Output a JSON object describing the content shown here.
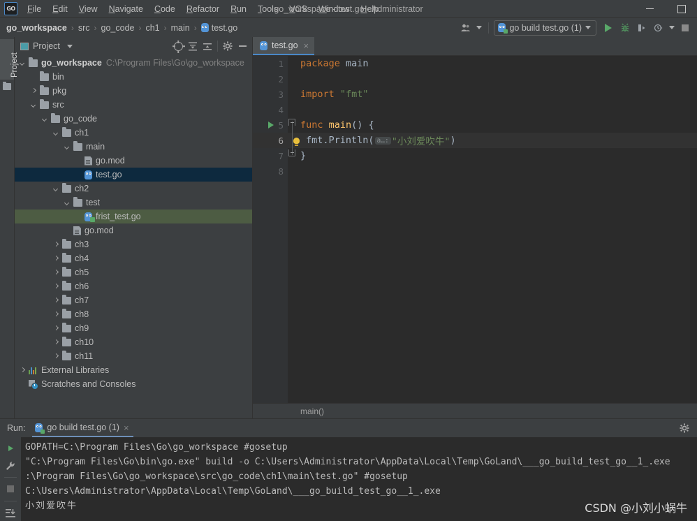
{
  "window": {
    "title": "go_workspace - test.go - Administrator",
    "logo": "goland-logo",
    "minimize": "minimize-button",
    "maximize": "maximize-button"
  },
  "menubar": {
    "items": [
      {
        "label": "File",
        "mnemonic": "F"
      },
      {
        "label": "Edit",
        "mnemonic": "E"
      },
      {
        "label": "View",
        "mnemonic": "V"
      },
      {
        "label": "Navigate",
        "mnemonic": "N"
      },
      {
        "label": "Code",
        "mnemonic": "C"
      },
      {
        "label": "Refactor",
        "mnemonic": "R"
      },
      {
        "label": "Run",
        "mnemonic": "R"
      },
      {
        "label": "Tools",
        "mnemonic": "T"
      },
      {
        "label": "VCS",
        "mnemonic": "V"
      },
      {
        "label": "Window",
        "mnemonic": "W"
      },
      {
        "label": "Help",
        "mnemonic": "H"
      }
    ]
  },
  "navbar": {
    "breadcrumbs": [
      {
        "label": "go_workspace",
        "bold": true
      },
      {
        "label": "src",
        "bold": false
      },
      {
        "label": "go_code",
        "bold": false
      },
      {
        "label": "ch1",
        "bold": false
      },
      {
        "label": "main",
        "bold": false
      },
      {
        "label": "test.go",
        "bold": false,
        "icon": "go-file-icon"
      }
    ],
    "separator": "›",
    "run_config": "go build test.go (1)",
    "icons": [
      "people-icon",
      "run-icon",
      "debug-icon",
      "run-coverage-icon",
      "profile-icon",
      "stop-icon"
    ]
  },
  "left_strip": {
    "tab_label": "Project"
  },
  "project_panel": {
    "title": "Project",
    "toolbar_icons": [
      "locate-icon",
      "expand-all-icon",
      "collapse-all-icon",
      "settings-gear-icon",
      "hide-icon"
    ],
    "tree": [
      {
        "depth": 0,
        "arrow": "down",
        "icon": "folder",
        "label": "go_workspace",
        "bold": true,
        "path": "C:\\Program Files\\Go\\go_workspace",
        "state": "none"
      },
      {
        "depth": 1,
        "arrow": "none",
        "icon": "folder",
        "label": "bin",
        "bold": false,
        "path": "",
        "state": "none"
      },
      {
        "depth": 1,
        "arrow": "right",
        "icon": "folder",
        "label": "pkg",
        "bold": false,
        "path": "",
        "state": "none"
      },
      {
        "depth": 1,
        "arrow": "down",
        "icon": "folder",
        "label": "src",
        "bold": false,
        "path": "",
        "state": "none"
      },
      {
        "depth": 2,
        "arrow": "down",
        "icon": "folder",
        "label": "go_code",
        "bold": false,
        "path": "",
        "state": "none"
      },
      {
        "depth": 3,
        "arrow": "down",
        "icon": "folder",
        "label": "ch1",
        "bold": false,
        "path": "",
        "state": "none"
      },
      {
        "depth": 4,
        "arrow": "down",
        "icon": "folder",
        "label": "main",
        "bold": false,
        "path": "",
        "state": "none"
      },
      {
        "depth": 5,
        "arrow": "none",
        "icon": "mod",
        "label": "go.mod",
        "bold": false,
        "path": "",
        "state": "none"
      },
      {
        "depth": 5,
        "arrow": "none",
        "icon": "gopher",
        "label": "test.go",
        "bold": false,
        "path": "",
        "state": "selected"
      },
      {
        "depth": 3,
        "arrow": "down",
        "icon": "folder",
        "label": "ch2",
        "bold": false,
        "path": "",
        "state": "none"
      },
      {
        "depth": 4,
        "arrow": "down",
        "icon": "folder",
        "label": "test",
        "bold": false,
        "path": "",
        "state": "none"
      },
      {
        "depth": 5,
        "arrow": "none",
        "icon": "gopher-test",
        "label": "frist_test.go",
        "bold": false,
        "path": "",
        "state": "highlight"
      },
      {
        "depth": 4,
        "arrow": "none",
        "icon": "mod",
        "label": "go.mod",
        "bold": false,
        "path": "",
        "state": "none"
      },
      {
        "depth": 3,
        "arrow": "right",
        "icon": "folder",
        "label": "ch3",
        "bold": false,
        "path": "",
        "state": "none"
      },
      {
        "depth": 3,
        "arrow": "right",
        "icon": "folder",
        "label": "ch4",
        "bold": false,
        "path": "",
        "state": "none"
      },
      {
        "depth": 3,
        "arrow": "right",
        "icon": "folder",
        "label": "ch5",
        "bold": false,
        "path": "",
        "state": "none"
      },
      {
        "depth": 3,
        "arrow": "right",
        "icon": "folder",
        "label": "ch6",
        "bold": false,
        "path": "",
        "state": "none"
      },
      {
        "depth": 3,
        "arrow": "right",
        "icon": "folder",
        "label": "ch7",
        "bold": false,
        "path": "",
        "state": "none"
      },
      {
        "depth": 3,
        "arrow": "right",
        "icon": "folder",
        "label": "ch8",
        "bold": false,
        "path": "",
        "state": "none"
      },
      {
        "depth": 3,
        "arrow": "right",
        "icon": "folder",
        "label": "ch9",
        "bold": false,
        "path": "",
        "state": "none"
      },
      {
        "depth": 3,
        "arrow": "right",
        "icon": "folder",
        "label": "ch10",
        "bold": false,
        "path": "",
        "state": "none"
      },
      {
        "depth": 3,
        "arrow": "right",
        "icon": "folder",
        "label": "ch11",
        "bold": false,
        "path": "",
        "state": "none"
      },
      {
        "depth": 0,
        "arrow": "right",
        "icon": "libs",
        "label": "External Libraries",
        "bold": false,
        "path": "",
        "state": "none"
      },
      {
        "depth": 0,
        "arrow": "none",
        "icon": "scratch",
        "label": "Scratches and Consoles",
        "bold": false,
        "path": "",
        "state": "none"
      }
    ]
  },
  "editor": {
    "tab": {
      "label": "test.go",
      "icon": "go-file-icon",
      "close": "×"
    },
    "lines": [
      {
        "num": "1",
        "current": false,
        "run_marker": false,
        "tokens": [
          {
            "t": "package ",
            "c": "kw"
          },
          {
            "t": "main",
            "c": "pl"
          }
        ]
      },
      {
        "num": "2",
        "current": false,
        "run_marker": false,
        "tokens": []
      },
      {
        "num": "3",
        "current": false,
        "run_marker": false,
        "tokens": [
          {
            "t": "import ",
            "c": "kw"
          },
          {
            "t": "\"fmt\"",
            "c": "str"
          }
        ]
      },
      {
        "num": "4",
        "current": false,
        "run_marker": false,
        "tokens": []
      },
      {
        "num": "5",
        "current": false,
        "run_marker": true,
        "tokens": [
          {
            "t": "func ",
            "c": "kw"
          },
          {
            "t": "main",
            "c": "fn"
          },
          {
            "t": "() {",
            "c": "pl"
          }
        ]
      },
      {
        "num": "6",
        "current": true,
        "run_marker": false,
        "tokens": []
      },
      {
        "num": "7",
        "current": false,
        "run_marker": false,
        "tokens": [
          {
            "t": "}",
            "c": "pl"
          }
        ]
      },
      {
        "num": "8",
        "current": false,
        "run_marker": false,
        "tokens": []
      }
    ],
    "line6": {
      "prefix": "fmt.Println(",
      "hint": "a…:",
      "string": "\"小刘爱吹牛\"",
      "suffix": ")"
    },
    "breadcrumb": "main()"
  },
  "run_panel": {
    "label": "Run:",
    "tab": "go build test.go (1)",
    "tab_close": "×",
    "toolbar_icons": [
      "rerun-icon",
      "settings-wrench-icon",
      "stop-icon",
      "scroll-to-end-icon"
    ],
    "gear": "settings-gear-icon",
    "console_lines": [
      "GOPATH=C:\\Program Files\\Go\\go_workspace #gosetup",
      "\"C:\\Program Files\\Go\\bin\\go.exe\" build -o C:\\Users\\Administrator\\AppData\\Local\\Temp\\GoLand\\___go_build_test_go__1_.exe",
      ":\\Program Files\\Go\\go_workspace\\src\\go_code\\ch1\\main\\test.go\" #gosetup",
      "C:\\Users\\Administrator\\AppData\\Local\\Temp\\GoLand\\___go_build_test_go__1_.exe"
    ],
    "console_output": "小刘爱吹牛",
    "watermark": "CSDN @小刘小蜗牛"
  },
  "colors": {
    "panel_bg": "#3c3f41",
    "editor_bg": "#2b2b2b",
    "accent_blue": "#4a88c7",
    "selection_blue": "#0d293e",
    "highlight_green": "#4d5c43",
    "run_green": "#59a869",
    "keyword_orange": "#cc7832",
    "string_green": "#6a8759",
    "function_yellow": "#ffc66d"
  }
}
